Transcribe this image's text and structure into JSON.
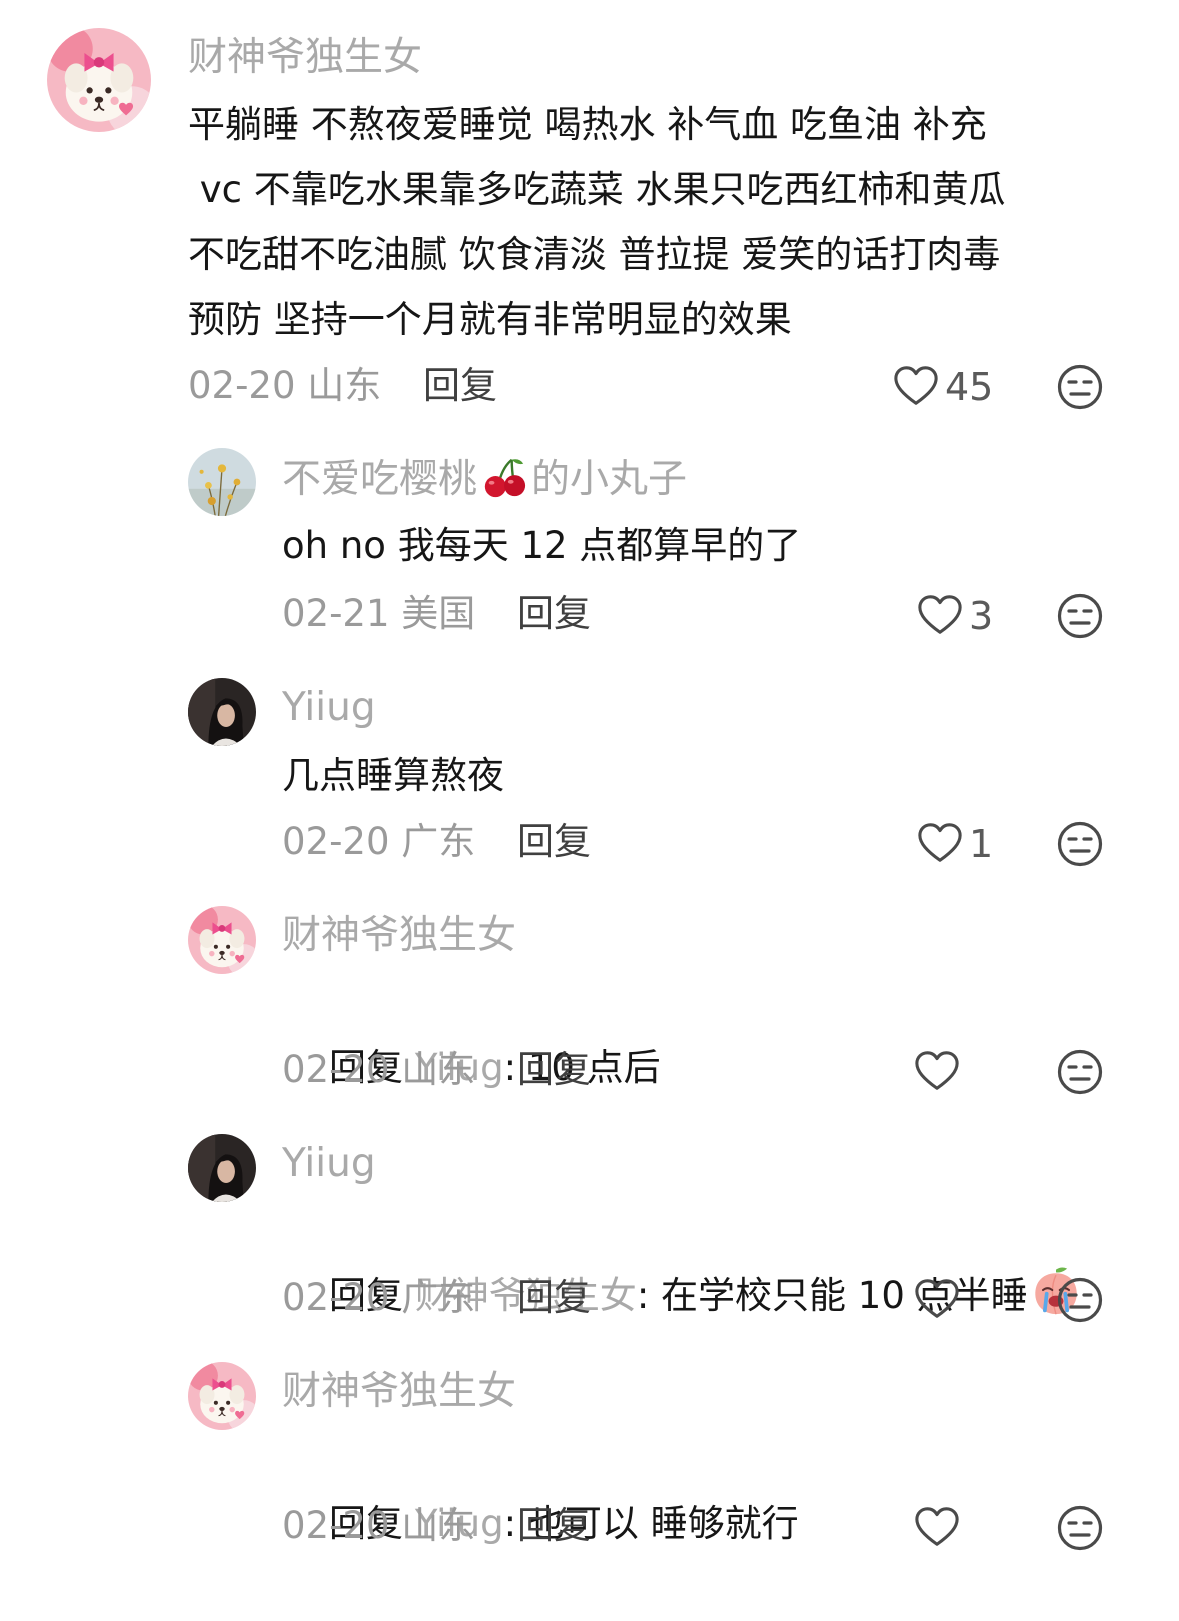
{
  "comments": [
    {
      "username": "财神爷独生女",
      "text": "平躺睡 不熬夜爱睡觉 喝热水 补气血 吃鱼油 补充\n vc 不靠吃水果靠多吃蔬菜 水果只吃西红柿和黄瓜\n不吃甜不吃油腻 饮食清淡 普拉提 爱笑的话打肉毒\n预防 坚持一个月就有非常明显的效果",
      "date": "02-20",
      "location": "山东",
      "reply_label": "回复",
      "likes": "45",
      "avatar": "cartoon-dog-avatar",
      "icons": {
        "like": "heart-outline-icon",
        "dislike": "meh-face-icon"
      }
    },
    {
      "username_before_emoji": "不爱吃樱桃",
      "username_emoji": "cherry-emoji",
      "username_after_emoji": "的小丸子",
      "text": "oh no 我每天 12 点都算早的了",
      "date": "02-21",
      "location": "美国",
      "reply_label": "回复",
      "likes": "3",
      "avatar": "flower-photo-avatar"
    },
    {
      "username": "Yiiug",
      "text": "几点睡算熬夜",
      "date": "02-20",
      "location": "广东",
      "reply_label": "回复",
      "likes": "1",
      "avatar": "woman-photo-avatar"
    },
    {
      "username": "财神爷独生女",
      "reply_prefix": "回复 ",
      "reply_target": "Yiiug",
      "text": ": 10 点后",
      "date": "02-20",
      "location": "山东",
      "reply_label": "回复",
      "likes": "",
      "avatar": "cartoon-dog-avatar"
    },
    {
      "username": "Yiiug",
      "reply_prefix": "回复 ",
      "reply_target": "财神爷独生女",
      "text": ": 在学校只能 10 点半睡",
      "trailing_emoji": "crying-peach-emoji",
      "date": "02-20",
      "location": "广东",
      "reply_label": "回复",
      "likes": "",
      "avatar": "woman-photo-avatar"
    },
    {
      "username": "财神爷独生女",
      "reply_prefix": "回复 ",
      "reply_target": "Yiiug",
      "text": ": 也可以 睡够就行",
      "date": "02-20",
      "location": "山东",
      "reply_label": "回复",
      "likes": "",
      "avatar": "cartoon-dog-avatar"
    }
  ]
}
